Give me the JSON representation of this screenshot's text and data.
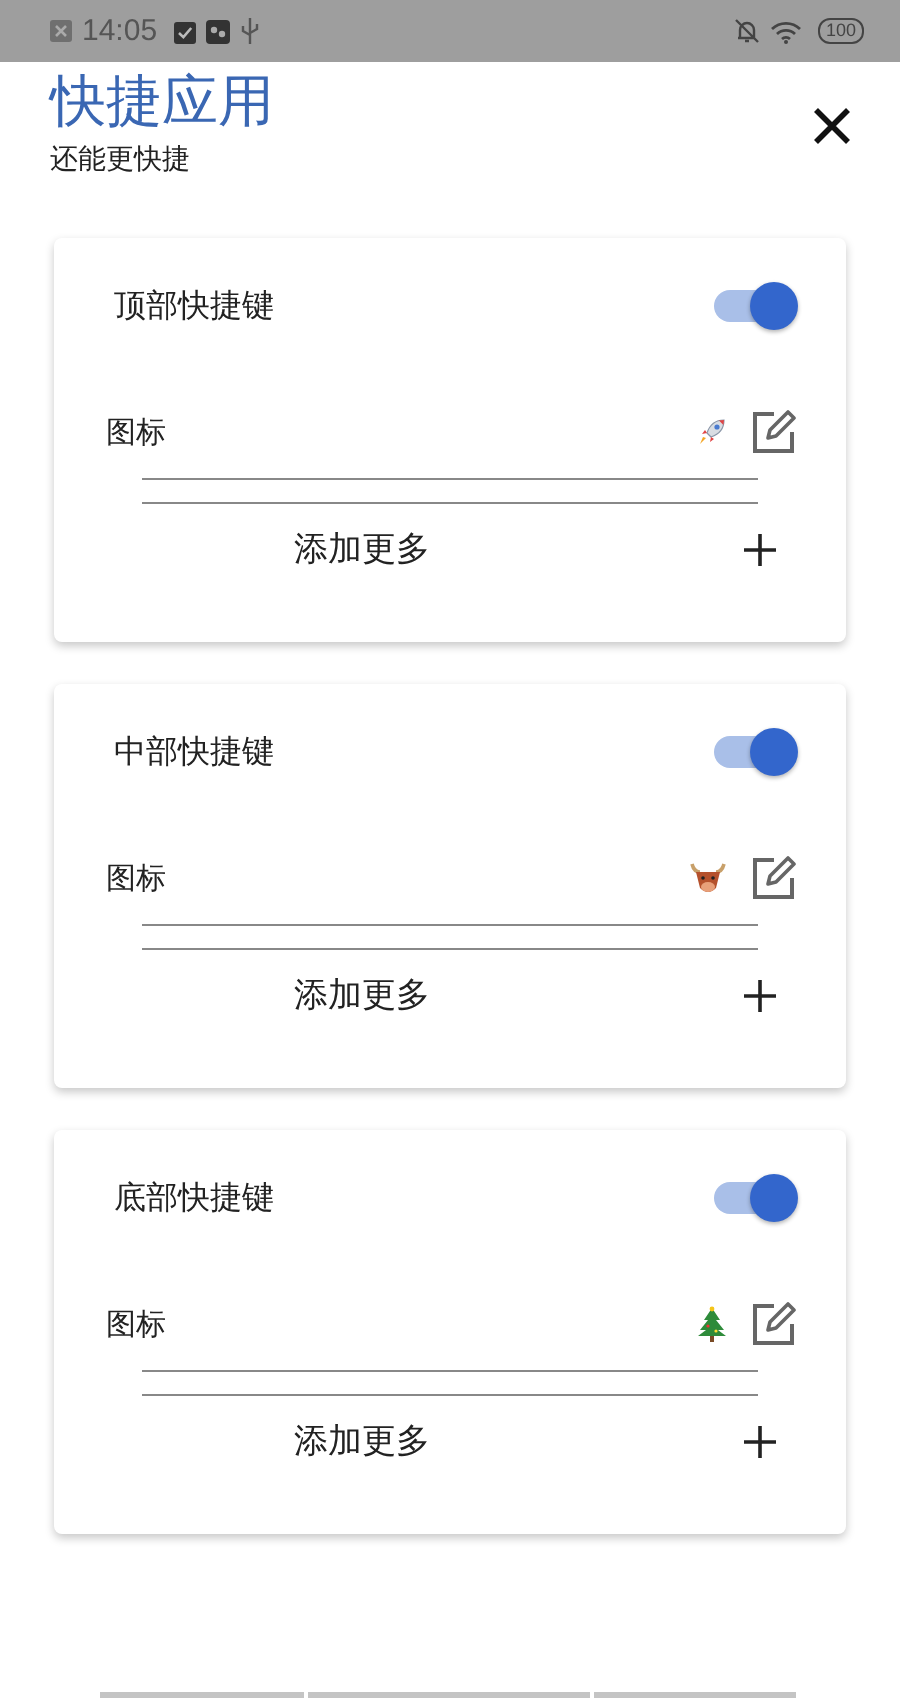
{
  "status_bar": {
    "time": "14:05",
    "battery": "100"
  },
  "header": {
    "title": "快捷应用",
    "subtitle": "还能更快捷"
  },
  "cards": [
    {
      "title": "顶部快捷键",
      "on": true,
      "icon_label": "图标",
      "add_label": "添加更多"
    },
    {
      "title": "中部快捷键",
      "on": true,
      "icon_label": "图标",
      "add_label": "添加更多"
    },
    {
      "title": "底部快捷键",
      "on": true,
      "icon_label": "图标",
      "add_label": "添加更多"
    }
  ]
}
